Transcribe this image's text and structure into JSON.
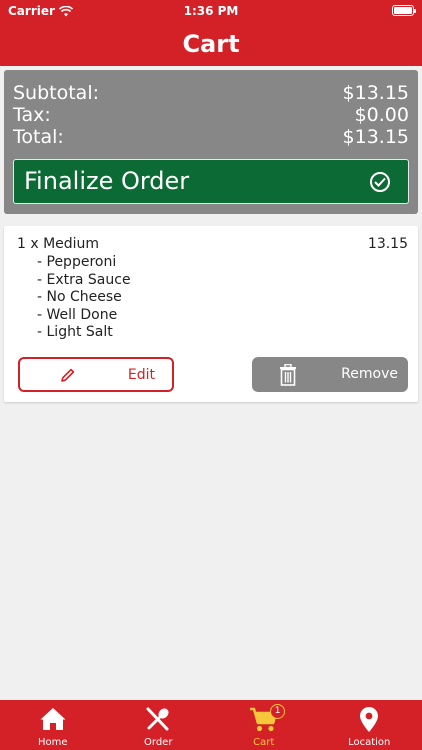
{
  "status_bar": {
    "carrier": "Carrier",
    "time": "1:36 PM"
  },
  "nav": {
    "title": "Cart"
  },
  "summary": {
    "subtotal_label": "Subtotal:",
    "subtotal_value": "$13.15",
    "tax_label": "Tax:",
    "tax_value": "$0.00",
    "total_label": "Total:",
    "total_value": "$13.15",
    "finalize_label": "Finalize Order"
  },
  "item": {
    "title": "1 x Medium",
    "price": "13.15",
    "options": [
      "- Pepperoni",
      "- Extra Sauce",
      "- No Cheese",
      "- Well Done",
      "- Light Salt"
    ],
    "edit_label": "Edit",
    "remove_label": "Remove"
  },
  "tabs": [
    {
      "label": "Home",
      "icon": "home-icon"
    },
    {
      "label": "Order",
      "icon": "utensils-icon"
    },
    {
      "label": "Cart",
      "icon": "cart-icon",
      "badge": "1",
      "active": true
    },
    {
      "label": "Location",
      "icon": "location-pin-icon"
    }
  ],
  "colors": {
    "brand_red": "#d42127",
    "finalize_green": "#0c6b35",
    "summary_gray": "#878787",
    "active_tab": "#f6c73a"
  }
}
